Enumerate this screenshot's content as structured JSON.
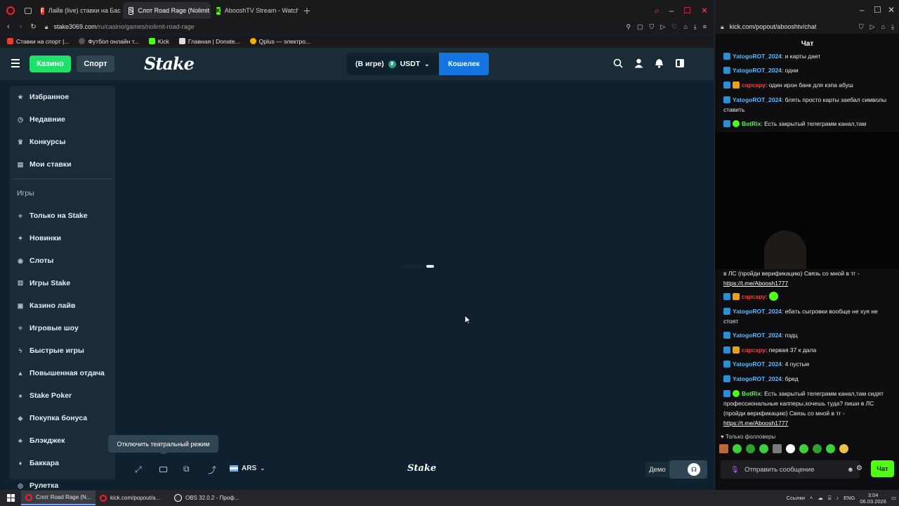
{
  "left_browser": {
    "tabs": [
      {
        "label": "Лайв (live) ставки на Бас",
        "favicon": "fonbet-icon",
        "color": "#e63b2e",
        "active": false
      },
      {
        "label": "Слот Road Rage (Nolimit C",
        "favicon": "stake-icon",
        "color": "#0f212e",
        "active": true
      },
      {
        "label": "AbooshTV Stream - Watch",
        "favicon": "kick-icon",
        "color": "#53fc18",
        "active": false
      }
    ],
    "address": {
      "domain": "stake3069.com",
      "path": "/ru/casino/games/nolimit-road-rage"
    },
    "bookmarks": [
      {
        "label": "Ставки на спорт |...",
        "color": "#e63b2e"
      },
      {
        "label": "Футбол онлайн т...",
        "color": "#333"
      },
      {
        "label": "Kick",
        "color": "#53fc18"
      },
      {
        "label": "Главная | Donate...",
        "color": "#222"
      },
      {
        "label": "Qplus — электро...",
        "color": "#f0b000"
      }
    ]
  },
  "stake": {
    "nav_casino": "Казино",
    "nav_sport": "Спорт",
    "logo": "Stake",
    "wallet_status": "(В игре)",
    "currency": "USDT",
    "wallet_button": "Кошелек",
    "sidebar_top": [
      {
        "label": "Избранное",
        "icon": "star-icon"
      },
      {
        "label": "Недавние",
        "icon": "clock-icon"
      },
      {
        "label": "Конкурсы",
        "icon": "trophy-icon"
      },
      {
        "label": "Мои ставки",
        "icon": "receipt-icon"
      }
    ],
    "games_section": "Игры",
    "sidebar_games": [
      {
        "label": "Только на Stake",
        "icon": "stake-icon"
      },
      {
        "label": "Новинки",
        "icon": "new-icon"
      },
      {
        "label": "Слоты",
        "icon": "slots-icon"
      },
      {
        "label": "Игры Stake",
        "icon": "dice-icon"
      },
      {
        "label": "Казино лайв",
        "icon": "live-icon"
      },
      {
        "label": "Игровые шоу",
        "icon": "show-icon"
      },
      {
        "label": "Быстрые игры",
        "icon": "lightning-icon"
      },
      {
        "label": "Повышенная отдача",
        "icon": "rtp-icon"
      },
      {
        "label": "Stake Poker",
        "icon": "poker-icon"
      },
      {
        "label": "Покупка бонуса",
        "icon": "bonus-icon"
      },
      {
        "label": "Блэкджек",
        "icon": "cards-icon"
      },
      {
        "label": "Баккара",
        "icon": "baccarat-icon"
      },
      {
        "label": "Рулетка",
        "icon": "roulette-icon"
      }
    ],
    "tooltip": "Отключить театральный режим",
    "footer_currency": "ARS",
    "footer_logo": "Stake",
    "demo_label": "Демо"
  },
  "right_browser": {
    "address": "kick.com/popout/abooshtv/chat",
    "chat_title": "Чат",
    "messages_top": [
      {
        "user": "YatogoROT_2024",
        "style": "blue",
        "text": ": и карты дает"
      },
      {
        "user": "YatogoROT_2024",
        "style": "blue",
        "text": ": одни"
      },
      {
        "user": "capcapy",
        "style": "red",
        "text": ": один ирон банк для кэпа абуш"
      },
      {
        "user": "YatogoROT_2024",
        "style": "blue",
        "text": ": блять просто карты заебал символы ставить"
      },
      {
        "user": "BotRix",
        "style": "green",
        "text": ": Есть закрытый телеграмм канал,там"
      }
    ],
    "overlap_text": "в ЛС (пройди верификацию) Связь со мной в тг -",
    "overlap_link": "https://t.me/Aboosh1777",
    "messages_bottom": [
      {
        "user": "capcapy",
        "style": "red",
        "text": ":"
      },
      {
        "user": "YatogoROT_2024",
        "style": "blue",
        "text": ": ебать сыгровки вообще не хуя не стоят"
      },
      {
        "user": "YatogoROT_2024",
        "style": "blue",
        "text": ": пздц"
      },
      {
        "user": "capcapy",
        "style": "red",
        "text": ": первая 37 к дала"
      },
      {
        "user": "YatogoROT_2024",
        "style": "blue",
        "text": ": 4 пустые"
      },
      {
        "user": "YatogoROT_2024",
        "style": "blue",
        "text": ": бред"
      },
      {
        "user": "BotRix",
        "style": "green",
        "text": ": Есть закрытый телеграмм канал,там сидят профессиональные капперы,хочешь туда? пиши в ЛС (пройди верификацию) Связь со мной в тг -"
      }
    ],
    "last_link": "https://t.me/Aboosh1777",
    "followers_only": "Только фолловеры",
    "input_placeholder": "Отправить сообщение",
    "send_label": "Чат"
  },
  "taskbar": {
    "items": [
      {
        "label": "Слот Road Rage (N...",
        "icon": "opera-icon"
      },
      {
        "label": "kick.com/popout/a...",
        "icon": "opera-icon"
      },
      {
        "label": "OBS 32.0.2 - Проф...",
        "icon": "obs-icon"
      }
    ],
    "links_label": "Ссылки",
    "lang": "ENG",
    "time": "3:04",
    "date": "06.03.2026"
  }
}
